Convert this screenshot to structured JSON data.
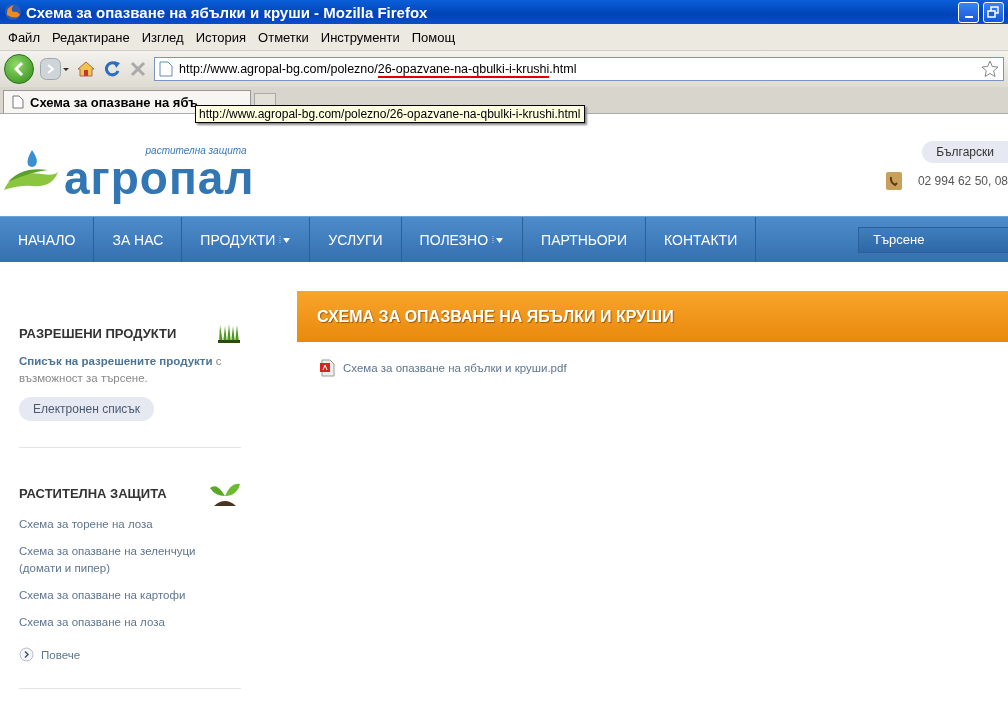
{
  "window": {
    "title": "Схема за опазване на ябълки и круши - Mozilla Firefox"
  },
  "menu": [
    "Файл",
    "Редактиране",
    "Изглед",
    "История",
    "Отметки",
    "Инструменти",
    "Помощ"
  ],
  "address_bar": {
    "url_start": "http://www.agropal-bg.com/polezno/",
    "url_marked": "26-opazvane-na-qbulki-i-krushi",
    "url_end": ".html"
  },
  "tabs": [
    {
      "label": "Схема за опазване на ябъ",
      "selected": true
    }
  ],
  "tooltip": "http://www.agropal-bg.com/polezno/26-opazvane-na-qbulki-i-krushi.html",
  "header": {
    "logo": "агропал",
    "tagline": "растителна защита",
    "language": "Български",
    "phone": "02 994 62 50, 08"
  },
  "nav": [
    {
      "label": "НАЧАЛО",
      "dropdown": false
    },
    {
      "label": "ЗА НАС",
      "dropdown": false
    },
    {
      "label": "ПРОДУКТИ",
      "dropdown": true
    },
    {
      "label": "УСЛУГИ",
      "dropdown": false
    },
    {
      "label": "ПОЛЕЗНО",
      "dropdown": true
    },
    {
      "label": "ПАРТНЬОРИ",
      "dropdown": false
    },
    {
      "label": "КОНТАКТИ",
      "dropdown": false
    }
  ],
  "search": {
    "placeholder": "Търсене"
  },
  "sidebar": [
    {
      "kind": "products",
      "title": "РАЗРЕШЕНИ ПРОДУКТИ",
      "text": "**Списък на разрешените продукти** с възможност за търсене.",
      "button": "Електронен списък"
    },
    {
      "kind": "links",
      "title": "РАСТИТЕЛНА ЗАЩИТА",
      "links": [
        "Схема за торене на лоза",
        "Схема за опазване на зеленчуци (домати и пипер)",
        "Схема за опазване на картофи",
        "Схема за опазване на лоза"
      ],
      "more": "Повече"
    }
  ],
  "article": {
    "title": "СХЕМА ЗА ОПАЗВАНЕ НА ЯБЪЛКИ И КРУШИ",
    "file": "Схема за опазване на ябълки и круши.pdf"
  }
}
